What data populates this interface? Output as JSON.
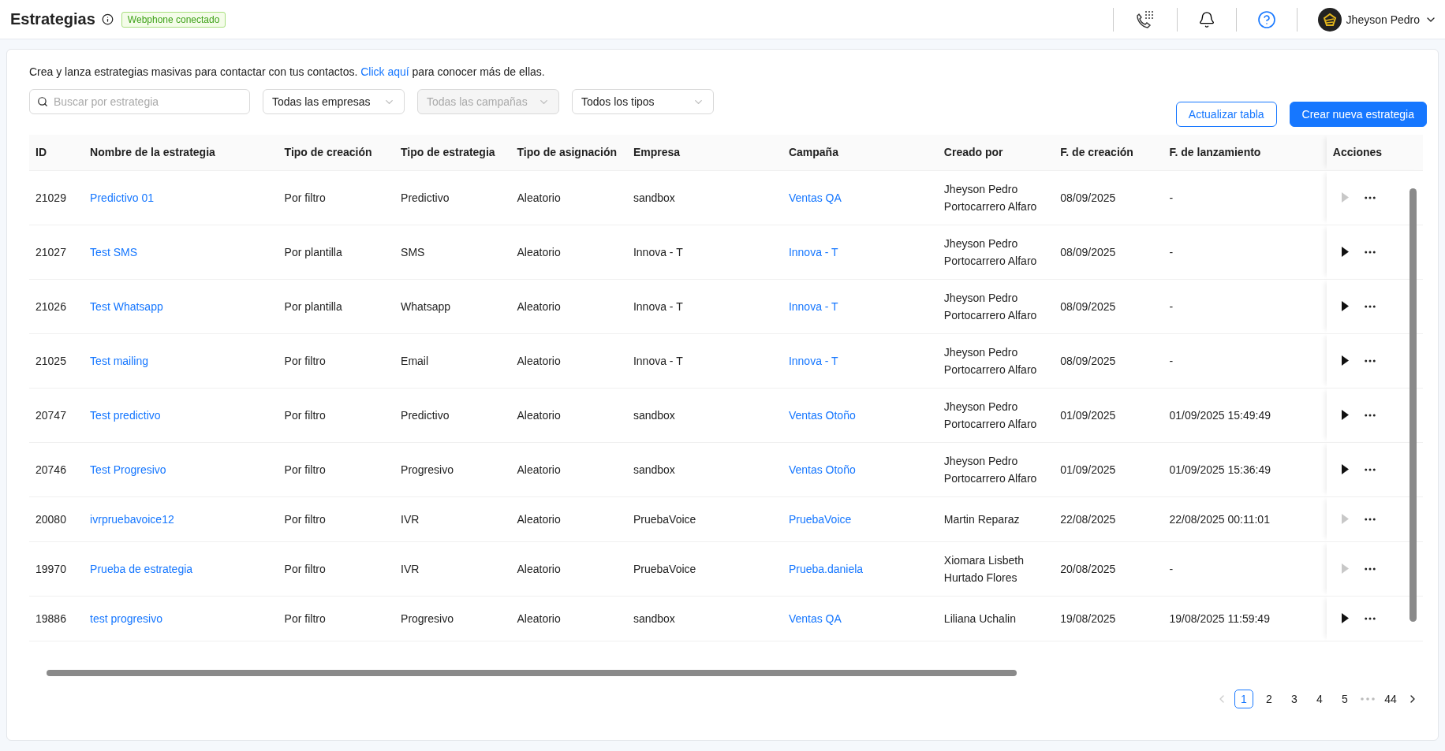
{
  "header": {
    "title": "Estrategias",
    "status_badge": "Webphone conectado",
    "user_name": "Jheyson Pedro"
  },
  "intro": {
    "text": "Crea y lanza estrategias masivas para contactar con tus contactos.",
    "link": "Click aquí",
    "text_after": "para conocer más de ellas."
  },
  "filters": {
    "search_placeholder": "Buscar por estrategia",
    "selects": [
      {
        "value": "Todas las empresas",
        "disabled": false
      },
      {
        "value": "Todas las campañas",
        "disabled": true
      },
      {
        "value": "Todos los tipos",
        "disabled": false
      }
    ]
  },
  "buttons": {
    "refresh": "Actualizar tabla",
    "create": "Crear nueva estrategia"
  },
  "table": {
    "columns": [
      "ID",
      "Nombre de la estrategia",
      "Tipo de creación",
      "Tipo de estrategia",
      "Tipo de asignación",
      "Empresa",
      "Campaña",
      "Creado por",
      "F. de creación",
      "F. de lanzamiento",
      "Acciones"
    ],
    "rows": [
      {
        "id": "21029",
        "name": "Predictivo 01",
        "creation": "Por filtro",
        "type": "Predictivo",
        "assignment": "Aleatorio",
        "company": "sandbox",
        "campaign": "Ventas QA",
        "created_by": "Jheyson Pedro Portocarrero Alfaro",
        "created": "08/09/2025",
        "launched": "-",
        "launch_enabled": false
      },
      {
        "id": "21027",
        "name": "Test SMS",
        "creation": "Por plantilla",
        "type": "SMS",
        "assignment": "Aleatorio",
        "company": "Innova - T",
        "campaign": "Innova - T",
        "created_by": "Jheyson Pedro Portocarrero Alfaro",
        "created": "08/09/2025",
        "launched": "-",
        "launch_enabled": true
      },
      {
        "id": "21026",
        "name": "Test Whatsapp",
        "creation": "Por plantilla",
        "type": "Whatsapp",
        "assignment": "Aleatorio",
        "company": "Innova - T",
        "campaign": "Innova - T",
        "created_by": "Jheyson Pedro Portocarrero Alfaro",
        "created": "08/09/2025",
        "launched": "-",
        "launch_enabled": true
      },
      {
        "id": "21025",
        "name": "Test mailing",
        "creation": "Por filtro",
        "type": "Email",
        "assignment": "Aleatorio",
        "company": "Innova - T",
        "campaign": "Innova - T",
        "created_by": "Jheyson Pedro Portocarrero Alfaro",
        "created": "08/09/2025",
        "launched": "-",
        "launch_enabled": true
      },
      {
        "id": "20747",
        "name": "Test predictivo",
        "creation": "Por filtro",
        "type": "Predictivo",
        "assignment": "Aleatorio",
        "company": "sandbox",
        "campaign": "Ventas Otoño",
        "created_by": "Jheyson Pedro Portocarrero Alfaro",
        "created": "01/09/2025",
        "launched": "01/09/2025 15:49:49",
        "launch_enabled": true
      },
      {
        "id": "20746",
        "name": "Test Progresivo",
        "creation": "Por filtro",
        "type": "Progresivo",
        "assignment": "Aleatorio",
        "company": "sandbox",
        "campaign": "Ventas Otoño",
        "created_by": "Jheyson Pedro Portocarrero Alfaro",
        "created": "01/09/2025",
        "launched": "01/09/2025 15:36:49",
        "launch_enabled": true
      },
      {
        "id": "20080",
        "name": "ivrpruebavoice12",
        "creation": "Por filtro",
        "type": "IVR",
        "assignment": "Aleatorio",
        "company": "PruebaVoice",
        "campaign": "PruebaVoice",
        "created_by": "Martin Reparaz",
        "created": "22/08/2025",
        "launched": "22/08/2025 00:11:01",
        "launch_enabled": false
      },
      {
        "id": "19970",
        "name": "Prueba de estrategia",
        "creation": "Por filtro",
        "type": "IVR",
        "assignment": "Aleatorio",
        "company": "PruebaVoice",
        "campaign": "Prueba.daniela",
        "created_by": "Xiomara Lisbeth Hurtado Flores",
        "created": "20/08/2025",
        "launched": "-",
        "launch_enabled": false
      },
      {
        "id": "19886",
        "name": "test progresivo",
        "creation": "Por filtro",
        "type": "Progresivo",
        "assignment": "Aleatorio",
        "company": "sandbox",
        "campaign": "Ventas QA",
        "created_by": "Liliana Uchalin",
        "created": "19/08/2025",
        "launched": "19/08/2025 11:59:49",
        "launch_enabled": true
      }
    ]
  },
  "pagination": {
    "pages": [
      {
        "label": "1",
        "selected": true
      },
      {
        "label": "2",
        "selected": false
      },
      {
        "label": "3",
        "selected": false
      },
      {
        "label": "4",
        "selected": false
      },
      {
        "label": "5",
        "selected": false
      },
      {
        "label": "44",
        "selected": false
      }
    ]
  }
}
